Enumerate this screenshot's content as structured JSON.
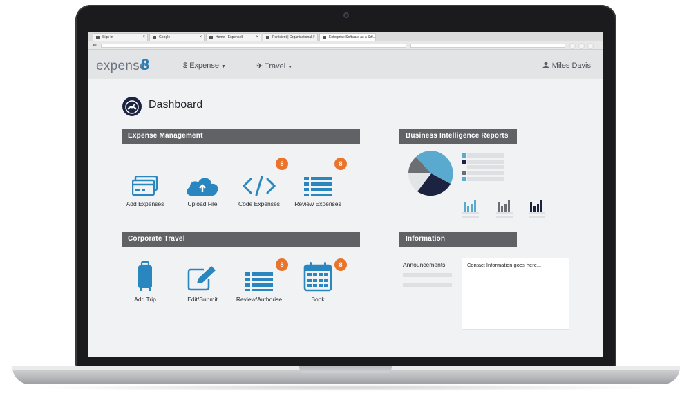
{
  "browser": {
    "tabs": [
      {
        "label": "Sign In"
      },
      {
        "label": "Google"
      },
      {
        "label": "Home - Expense8"
      },
      {
        "label": "Perficient | Organisational..."
      },
      {
        "label": "Enterprise Software as a Ser..."
      }
    ]
  },
  "app": {
    "logo_text": "expense",
    "logo_mark": "8",
    "nav": [
      {
        "label": "Expense",
        "icon": "dollar-icon"
      },
      {
        "label": "Travel",
        "icon": "plane-icon"
      }
    ],
    "user_name": "Miles Davis"
  },
  "dashboard": {
    "title": "Dashboard",
    "expense_section": {
      "title": "Expense Management",
      "tiles": [
        {
          "label": "Add Expenses",
          "icon": "credit-card-icon"
        },
        {
          "label": "Upload File",
          "icon": "cloud-upload-icon"
        },
        {
          "label": "Code Expenses",
          "icon": "code-icon",
          "badge": "8"
        },
        {
          "label": "Review Expenses",
          "icon": "list-icon",
          "badge": "8"
        }
      ]
    },
    "travel_section": {
      "title": "Corporate Travel",
      "tiles": [
        {
          "label": "Add Trip",
          "icon": "luggage-icon"
        },
        {
          "label": "Edit/Submit",
          "icon": "edit-icon"
        },
        {
          "label": "Review/Authorise",
          "icon": "list-icon",
          "badge": "8"
        },
        {
          "label": "Book",
          "icon": "calendar-icon",
          "badge": "8"
        }
      ]
    },
    "bi_section": {
      "title": "Business Intelligence Reports"
    },
    "info_section": {
      "title": "Information",
      "announcements_label": "Announcements",
      "contact_text": "Contact Information goes here..."
    }
  },
  "colors": {
    "accent": "#2a86bf",
    "badge": "#e8752b",
    "navy": "#1c2340",
    "gray": "#6b6e73"
  }
}
